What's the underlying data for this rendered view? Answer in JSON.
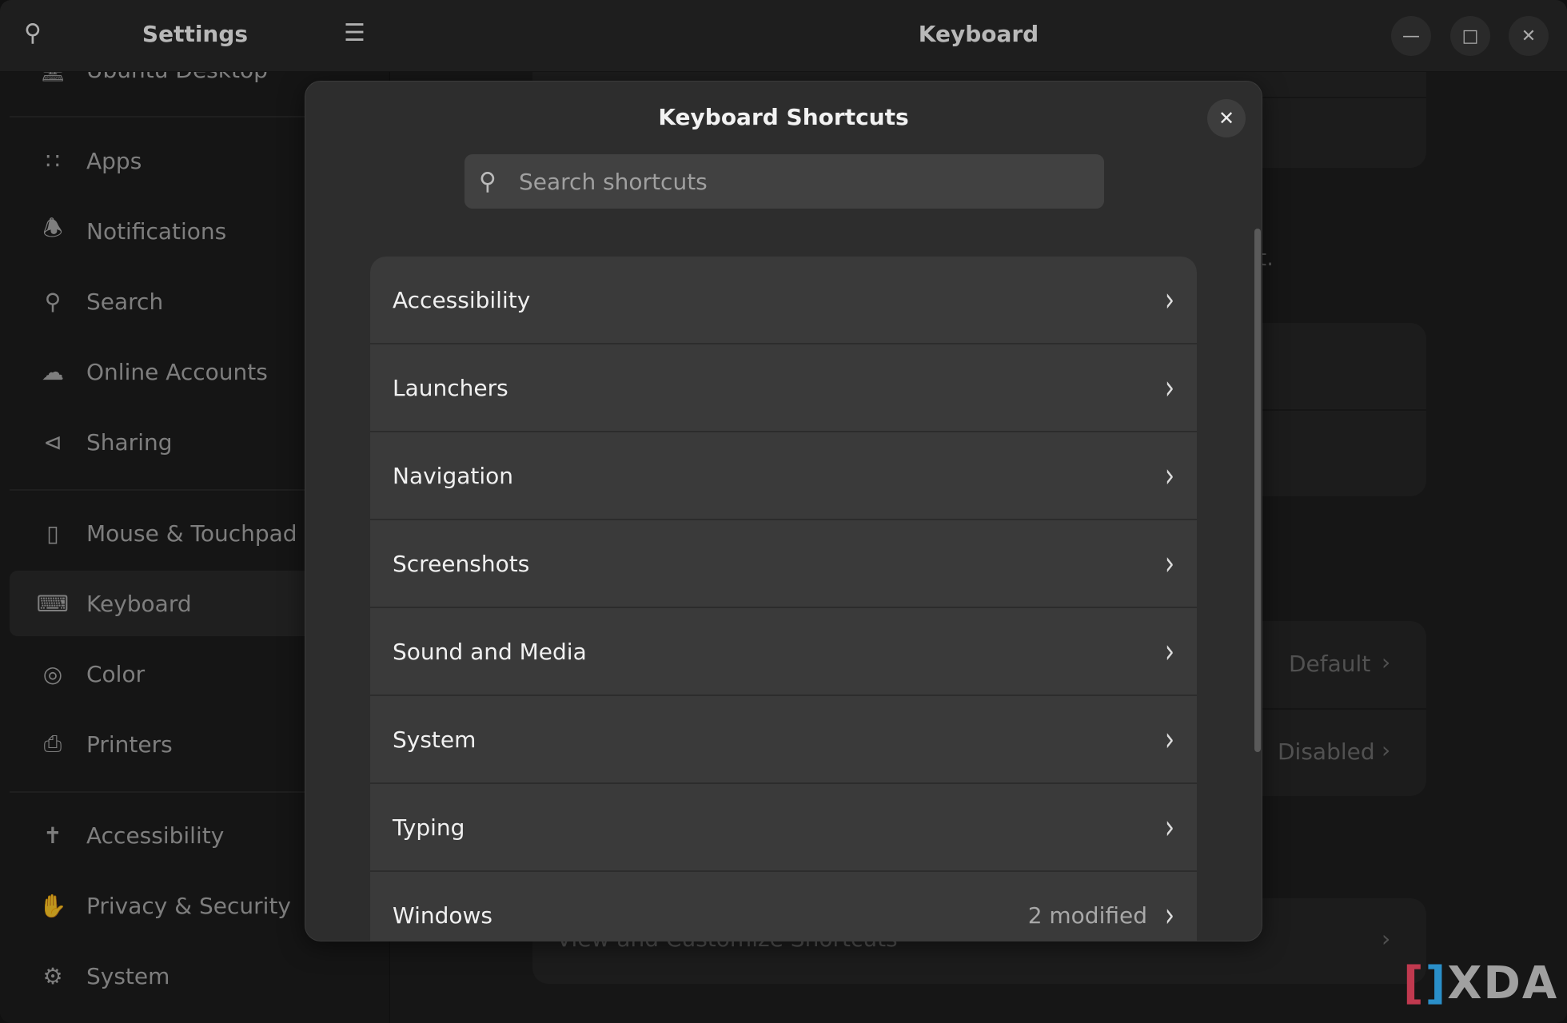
{
  "window": {
    "title": "Keyboard",
    "controls": [
      "minimize",
      "maximize",
      "close"
    ]
  },
  "sidebar": {
    "title": "Settings",
    "partial_item": "Ubuntu Desktop",
    "items": [
      {
        "label": "Apps",
        "icon": "apps-grid-icon"
      },
      {
        "label": "Notifications",
        "icon": "bell-icon"
      },
      {
        "label": "Search",
        "icon": "search-icon"
      },
      {
        "label": "Online Accounts",
        "icon": "cloud-icon"
      },
      {
        "label": "Sharing",
        "icon": "share-icon"
      },
      {
        "label": "Mouse & Touchpad",
        "icon": "mouse-icon"
      },
      {
        "label": "Keyboard",
        "icon": "keyboard-icon",
        "selected": true
      },
      {
        "label": "Color",
        "icon": "color-icon"
      },
      {
        "label": "Printers",
        "icon": "printer-icon"
      },
      {
        "label": "Accessibility",
        "icon": "accessibility-icon"
      },
      {
        "label": "Privacy & Security",
        "icon": "hand-icon"
      },
      {
        "label": "System",
        "icon": "gear-icon"
      }
    ]
  },
  "background": {
    "partial_text": "cut.",
    "rows": [
      {
        "value": "Default"
      },
      {
        "value": "Disabled"
      }
    ],
    "shortcuts_row": "View and Customize Shortcuts"
  },
  "dialog": {
    "title": "Keyboard Shortcuts",
    "search_placeholder": "Search shortcuts",
    "categories": [
      {
        "label": "Accessibility",
        "status": ""
      },
      {
        "label": "Launchers",
        "status": ""
      },
      {
        "label": "Navigation",
        "status": ""
      },
      {
        "label": "Screenshots",
        "status": ""
      },
      {
        "label": "Sound and Media",
        "status": ""
      },
      {
        "label": "System",
        "status": ""
      },
      {
        "label": "Typing",
        "status": ""
      },
      {
        "label": "Windows",
        "status": "2 modified"
      }
    ]
  },
  "watermark": "XDA",
  "colors": {
    "accent_red": "#c0394f",
    "accent_blue": "#2a8fc9"
  }
}
